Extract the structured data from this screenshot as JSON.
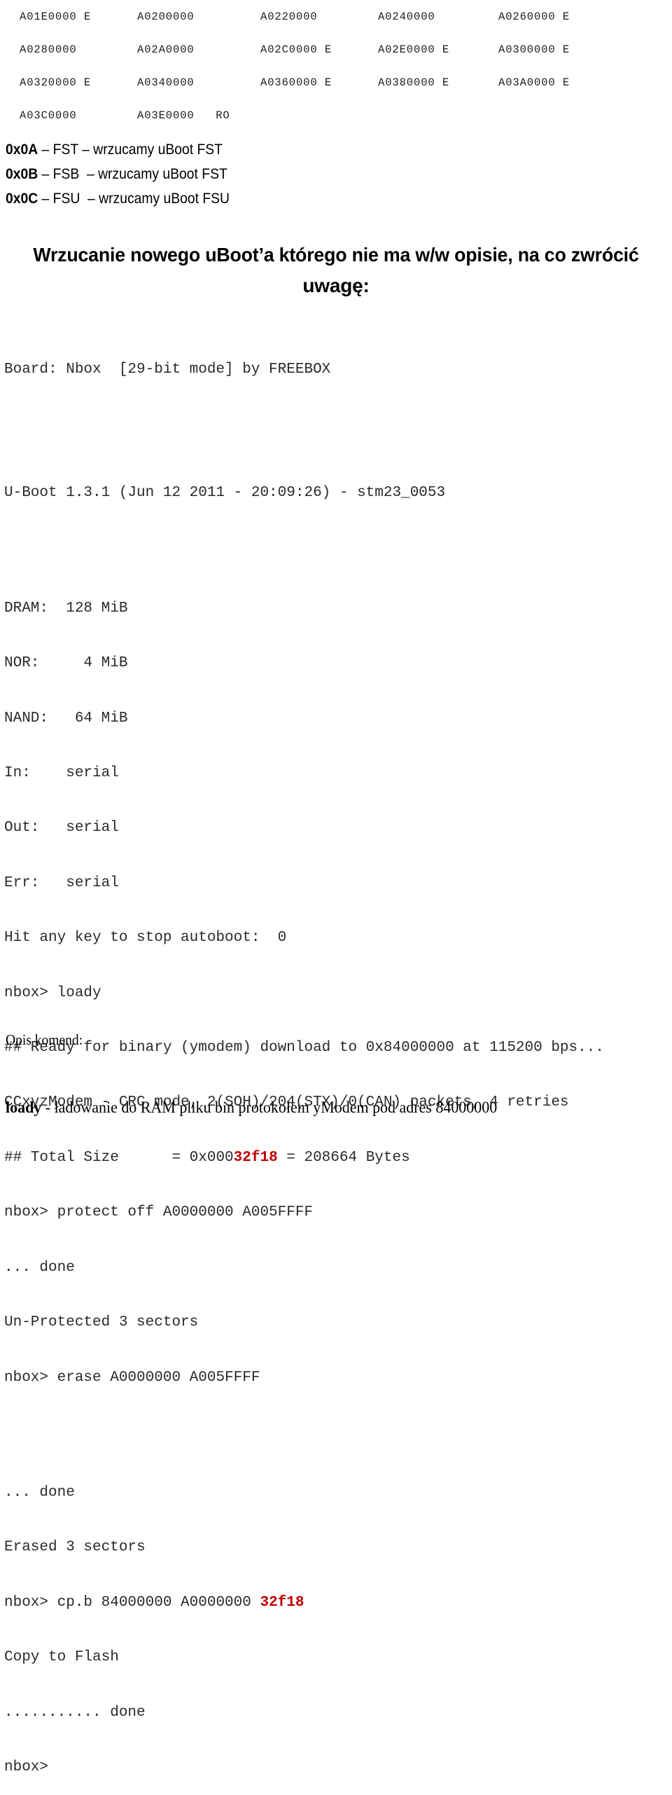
{
  "address_table": {
    "rows": [
      [
        "A01E0000 E",
        "A0200000",
        "A0220000",
        "A0240000",
        "A0260000 E"
      ],
      [
        "A0280000",
        "A02A0000",
        "A02C0000 E",
        "A02E0000 E",
        "A0300000 E"
      ],
      [
        "A0320000 E",
        "A0340000",
        "A0360000 E",
        "A0380000 E",
        "A03A0000 E"
      ],
      [
        "A03C0000",
        "A03E0000   RO",
        "",
        "",
        ""
      ]
    ]
  },
  "code_list": [
    {
      "key": "0x0A",
      "rest": " – FST – wrzucamy uBoot FST"
    },
    {
      "key": "0x0B",
      "rest": " – FSB  – wrzucamy uBoot FST"
    },
    {
      "key": "0x0C",
      "rest": " – FSU  – wrzucamy uBoot FSU"
    }
  ],
  "heading": {
    "line1": "Wrzucanie nowego uBoot’a którego nie ma w/w opisie, na co zwrócić",
    "line2": "uwagę:"
  },
  "console": {
    "board": "Board: Nbox  [29-bit mode] by FREEBOX",
    "uboot_version": "U-Boot 1.3.1 (Jun 12 2011 - 20:09:26) - stm23_0053",
    "dram": "DRAM:  128 MiB",
    "nor": "NOR:     4 MiB",
    "nand": "NAND:   64 MiB",
    "in": "In:    serial",
    "out": "Out:   serial",
    "err": "Err:   serial",
    "autoboot": "Hit any key to stop autoboot:  0",
    "cmd_loady": "nbox> loady",
    "ready": "## Ready for binary (ymodem) download to 0x84000000 at 115200 bps...",
    "crc": "CCxyzModem - CRC mode, 2(SOH)/204(STX)/0(CAN) packets, 4 retries",
    "total_size_pre": "## Total Size      = 0x000",
    "total_size_hot": "32f18",
    "total_size_post": " = 208664 Bytes",
    "cmd_protect": "nbox> protect off A0000000 A005FFFF",
    "done1": "... done",
    "unprotected": "Un-Protected 3 sectors",
    "cmd_erase": "nbox> erase A0000000 A005FFFF",
    "done2": "... done",
    "erased": "Erased 3 sectors",
    "cmd_cpb_pre": "nbox> cp.b 84000000 A0000000 ",
    "cmd_cpb_hot": "32f18",
    "copy_to_flash": "Copy to Flash",
    "done3": "........... done",
    "prompt": "nbox>"
  },
  "footer": {
    "notes_title": "Opis komend:",
    "loady_cmd": "loady",
    "loady_desc": " - ładowanie do RAM pliku bin protokołem yModem pod adres 84000000"
  },
  "colors": {
    "highlight_red": "#c00000",
    "text": "#000000",
    "console_text": "#2a2a2a",
    "background": "#ffffff"
  }
}
